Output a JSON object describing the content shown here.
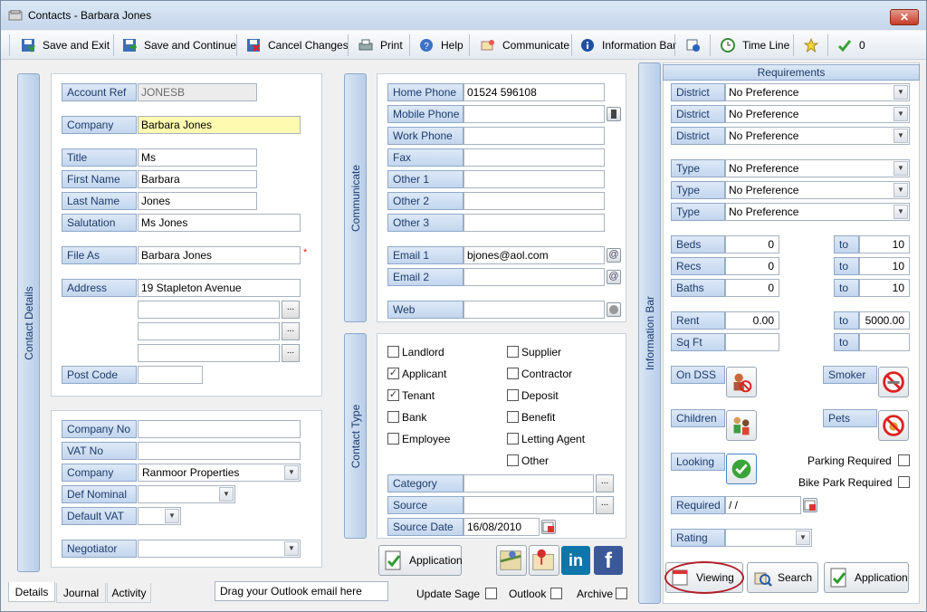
{
  "window": {
    "title": "Contacts  - Barbara Jones",
    "close": "✕"
  },
  "toolbar": {
    "save_exit": "Save and Exit",
    "save_continue": "Save and Continue",
    "cancel": "Cancel Changes",
    "print": "Print",
    "help": "Help",
    "communicate": "Communicate",
    "info_bar": "Information Bar",
    "timeline": "Time Line",
    "count": "0"
  },
  "contact_details": {
    "tab_label": "Contact Details",
    "account_ref": {
      "label": "Account Ref",
      "value": "JONESB"
    },
    "company": {
      "label": "Company",
      "value": "Barbara Jones"
    },
    "title": {
      "label": "Title",
      "value": "Ms"
    },
    "first_name": {
      "label": "First Name",
      "value": "Barbara"
    },
    "last_name": {
      "label": "Last Name",
      "value": "Jones"
    },
    "salutation": {
      "label": "Salutation",
      "value": "Ms Jones"
    },
    "file_as": {
      "label": "File As",
      "value": "Barbara Jones",
      "required": "*"
    },
    "address": {
      "label": "Address",
      "line1": "19 Stapleton Avenue",
      "line2": "",
      "line3": "",
      "line4": ""
    },
    "post_code": {
      "label": "Post Code",
      "value": ""
    },
    "company_no": {
      "label": "Company No",
      "value": ""
    },
    "vat_no": {
      "label": "VAT No",
      "value": ""
    },
    "company2": {
      "label": "Company",
      "value": "Ranmoor Properties"
    },
    "def_nominal": {
      "label": "Def Nominal",
      "value": ""
    },
    "default_vat": {
      "label": "Default VAT",
      "value": ""
    },
    "negotiator": {
      "label": "Negotiator",
      "value": ""
    }
  },
  "communicate": {
    "tab_label": "Communicate",
    "home_phone": {
      "label": "Home Phone",
      "value": "01524 596108"
    },
    "mobile_phone": {
      "label": "Mobile Phone",
      "value": ""
    },
    "work_phone": {
      "label": "Work Phone",
      "value": ""
    },
    "fax": {
      "label": "Fax",
      "value": ""
    },
    "other1": {
      "label": "Other 1",
      "value": ""
    },
    "other2": {
      "label": "Other 2",
      "value": ""
    },
    "other3": {
      "label": "Other 3",
      "value": ""
    },
    "email1": {
      "label": "Email 1",
      "value": "bjones@aol.com"
    },
    "email2": {
      "label": "Email 2",
      "value": ""
    },
    "web": {
      "label": "Web",
      "value": ""
    }
  },
  "contact_type": {
    "tab_label": "Contact Type",
    "types": [
      {
        "label": "Landlord",
        "checked": false
      },
      {
        "label": "Applicant",
        "checked": true
      },
      {
        "label": "Tenant",
        "checked": true
      },
      {
        "label": "Bank",
        "checked": false
      },
      {
        "label": "Employee",
        "checked": false
      },
      {
        "label": "Supplier",
        "checked": false
      },
      {
        "label": "Contractor",
        "checked": false
      },
      {
        "label": "Deposit",
        "checked": false
      },
      {
        "label": "Benefit",
        "checked": false
      },
      {
        "label": "Letting Agent",
        "checked": false
      },
      {
        "label": "Other",
        "checked": false
      }
    ],
    "category": {
      "label": "Category",
      "value": ""
    },
    "source": {
      "label": "Source",
      "value": ""
    },
    "source_date": {
      "label": "Source Date",
      "value": "16/08/2010"
    }
  },
  "application_button": "Application",
  "information_bar": {
    "tab_label": "Information Bar"
  },
  "requirements": {
    "header": "Requirements",
    "district1": {
      "label": "District",
      "value": "No Preference"
    },
    "district2": {
      "label": "District",
      "value": "No Preference"
    },
    "district3": {
      "label": "District",
      "value": "No Preference"
    },
    "type1": {
      "label": "Type",
      "value": "No Preference"
    },
    "type2": {
      "label": "Type",
      "value": "No Preference"
    },
    "type3": {
      "label": "Type",
      "value": "No Preference"
    },
    "beds": {
      "label": "Beds",
      "from": "0",
      "to_label": "to",
      "to": "10"
    },
    "recs": {
      "label": "Recs",
      "from": "0",
      "to_label": "to",
      "to": "10"
    },
    "baths": {
      "label": "Baths",
      "from": "0",
      "to_label": "to",
      "to": "10"
    },
    "rent": {
      "label": "Rent",
      "from": "0.00",
      "to_label": "to",
      "to": "5000.00"
    },
    "sqft": {
      "label": "Sq Ft",
      "from": "",
      "to_label": "to",
      "to": ""
    },
    "on_dss": "On DSS",
    "smoker": "Smoker",
    "children": "Children",
    "pets": "Pets",
    "looking": "Looking",
    "parking_required": "Parking Required",
    "bike_park_required": "Bike Park Required",
    "required": {
      "label": "Required",
      "value": " / /"
    },
    "rating": {
      "label": "Rating",
      "value": ""
    },
    "viewing": "Viewing",
    "search": "Search",
    "application": "Application"
  },
  "bottom": {
    "tab_details": "Details",
    "tab_journal": "Journal",
    "tab_activity": "Activity",
    "outlook_drop": "Drag your Outlook email here",
    "update_sage": "Update Sage",
    "outlook": "Outlook",
    "archive": "Archive"
  }
}
